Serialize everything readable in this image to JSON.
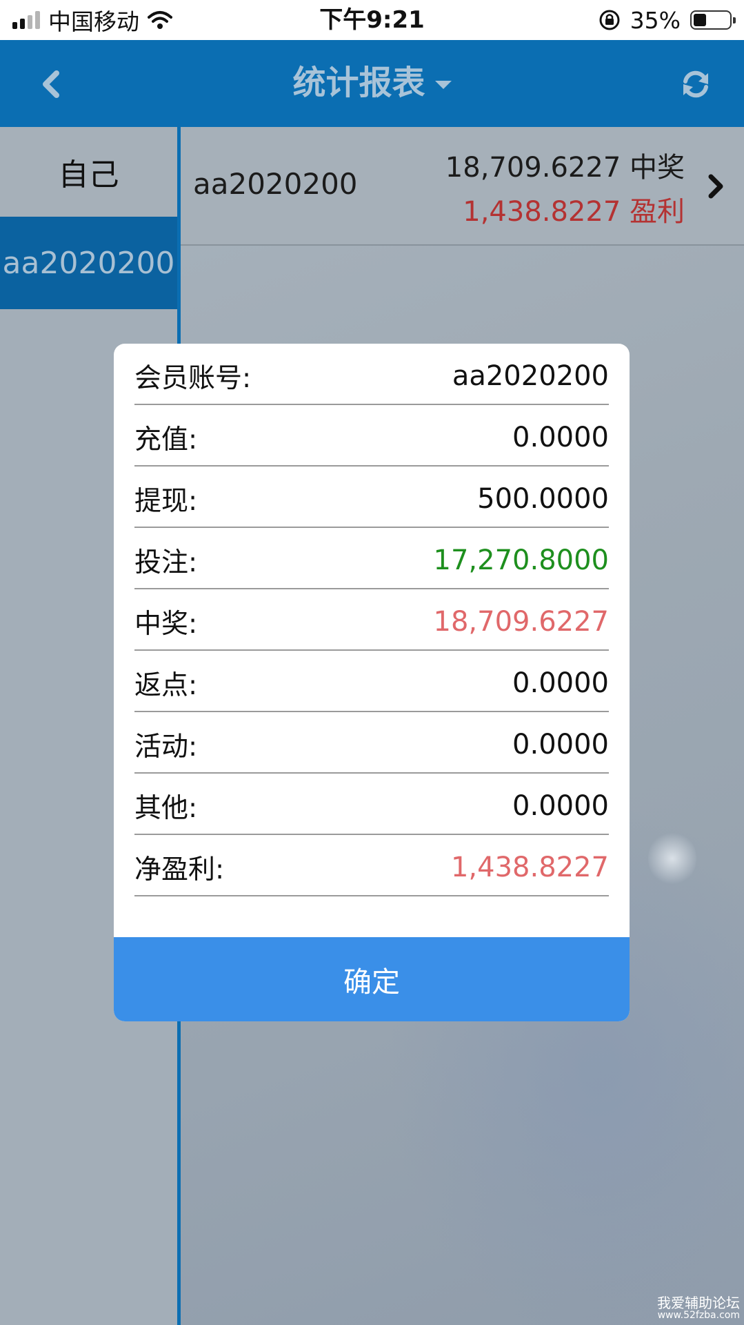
{
  "status_bar": {
    "carrier": "中国移动",
    "time": "下午9:21",
    "battery_percent": "35%",
    "battery_level": 0.35
  },
  "nav": {
    "title": "统计报表",
    "back_icon": "chevron-left-icon",
    "refresh_icon": "refresh-icon"
  },
  "sidebar": {
    "items": [
      {
        "label": "自己",
        "selected": false
      },
      {
        "label": "aa2020200",
        "selected": true
      }
    ]
  },
  "member_row": {
    "name": "aa2020200",
    "win_value": "18,709.6227",
    "win_label": "中奖",
    "profit_value": "1,438.8227",
    "profit_label": "盈利"
  },
  "modal": {
    "rows": [
      {
        "label": "会员账号:",
        "value": "aa2020200"
      },
      {
        "label": "充值:",
        "value": "0.0000"
      },
      {
        "label": "提现:",
        "value": "500.0000"
      },
      {
        "label": "投注:",
        "value": "17,270.8000",
        "color": "#1e8f1e"
      },
      {
        "label": "中奖:",
        "value": "18,709.6227",
        "color": "#e0686a"
      },
      {
        "label": "返点:",
        "value": "0.0000"
      },
      {
        "label": "活动:",
        "value": "0.0000"
      },
      {
        "label": "其他:",
        "value": "0.0000"
      },
      {
        "label": "净盈利:",
        "value": "1,438.8227",
        "color": "#e0686a"
      }
    ],
    "confirm_label": "确定"
  },
  "watermark": {
    "line1": "我爱辅助论坛",
    "line2": "www.52fzba.com"
  },
  "colors": {
    "nav_bg": "#0b6eb2",
    "confirm_bg": "#3a8fe8",
    "positive_red": "#e0686a",
    "bet_green": "#1e8f1e"
  }
}
